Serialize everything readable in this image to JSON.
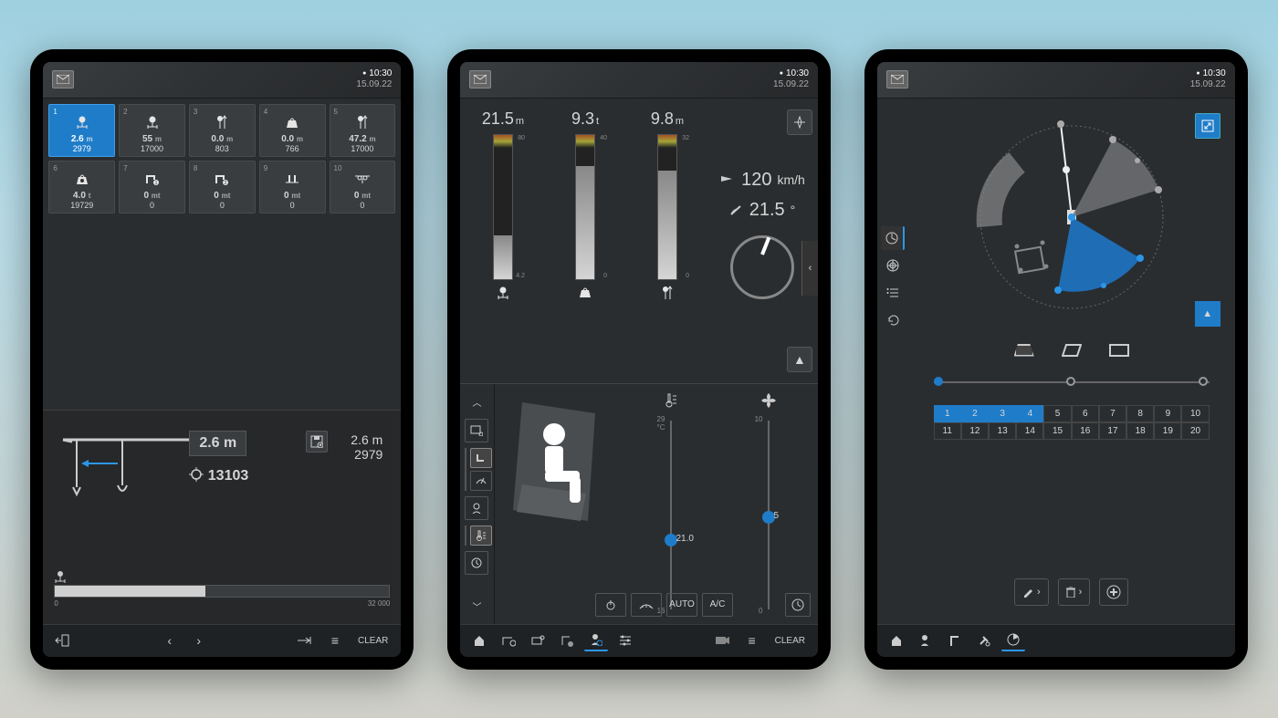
{
  "status": {
    "time": "10:30",
    "date": "15.09.22"
  },
  "t1": {
    "tiles": [
      {
        "n": "1",
        "v1": "2.6",
        "u1": "m",
        "v2": "2979",
        "sel": true,
        "icon": "radius"
      },
      {
        "n": "2",
        "v1": "55",
        "u1": "m",
        "v2": "17000",
        "icon": "radius"
      },
      {
        "n": "3",
        "v1": "0.0",
        "u1": "m",
        "v2": "803",
        "icon": "height-arrow"
      },
      {
        "n": "4",
        "v1": "0.0",
        "u1": "m",
        "v2": "766",
        "icon": "load"
      },
      {
        "n": "5",
        "v1": "47.2",
        "u1": "m",
        "v2": "17000",
        "icon": "height-arrow"
      },
      {
        "n": "6",
        "v1": "4.0",
        "u1": "t",
        "v2": "19729",
        "icon": "load-lock"
      },
      {
        "n": "7",
        "v1": "0",
        "u1": "mt",
        "v2": "0",
        "icon": "profile-1"
      },
      {
        "n": "8",
        "v1": "0",
        "u1": "mt",
        "v2": "0",
        "icon": "profile-2"
      },
      {
        "n": "9",
        "v1": "0",
        "u1": "mt",
        "v2": "0",
        "icon": "ground"
      },
      {
        "n": "10",
        "v1": "0",
        "u1": "mt",
        "v2": "0",
        "icon": "trolley"
      }
    ],
    "box_val": "2.6",
    "box_unit": "m",
    "target_val": "13103",
    "right_v1": "2.6",
    "right_u1": "m",
    "right_v2": "2979",
    "range_min": "0",
    "range_max": "32 000",
    "footer_clear": "CLEAR"
  },
  "t2": {
    "gauges": [
      {
        "val": "21.5",
        "unit": "m",
        "max": "80",
        "min": "4.2",
        "fill": 0.3,
        "icon": "radius"
      },
      {
        "val": "9.3",
        "unit": "t",
        "max": "40",
        "min": "0",
        "fill": 0.78,
        "icon": "load"
      },
      {
        "val": "9.8",
        "unit": "m",
        "max": "32",
        "min": "0",
        "fill": 0.75,
        "icon": "height"
      }
    ],
    "wind_speed": "120",
    "wind_unit": "km/h",
    "angle": "21.5",
    "angle_unit": "°",
    "temp": {
      "val": "21.0",
      "min": "16",
      "max": "29",
      "unit": "°C"
    },
    "fan": {
      "val": "5",
      "min": "0",
      "max": "10"
    },
    "buttons": {
      "auto": "AUTO",
      "ac": "A/C"
    },
    "footer_clear": "CLEAR"
  },
  "t3": {
    "steps": 3,
    "nums_row1": [
      "1",
      "2",
      "3",
      "4",
      "5",
      "6",
      "7",
      "8",
      "9",
      "10"
    ],
    "nums_row2": [
      "11",
      "12",
      "13",
      "14",
      "15",
      "16",
      "17",
      "18",
      "19",
      "20"
    ],
    "selected_count": 4
  }
}
